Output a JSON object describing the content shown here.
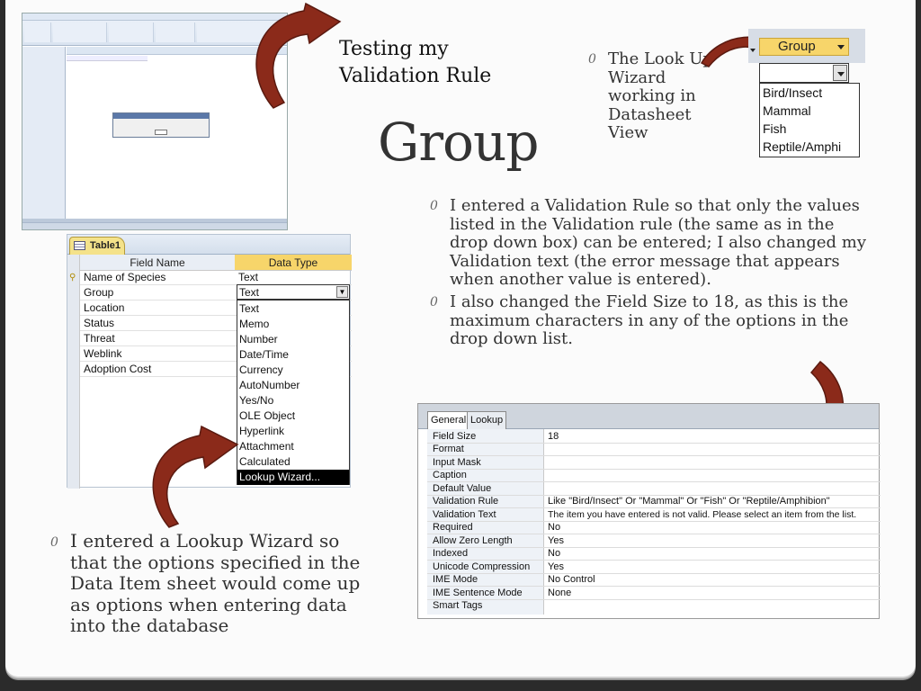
{
  "slide": {
    "title": "Group",
    "testing_label": "Testing my Validation Rule",
    "bullet_mark": "0",
    "lookup_wizard_note": "The Look Up Wizard working in Datasheet View",
    "validation_rule_note": "I entered a Validation Rule so that only the values listed in the Validation rule (the same as in the drop down box) can be entered; I also changed my Validation text (the error message that appears when another value is entered).",
    "field_size_note": " I also changed the Field Size to 18, as this is the maximum characters in any of the options in the drop down list.",
    "lookup_bottom_note": "I entered a Lookup Wizard so that the options specified in the Data Item sheet would come up as options when entering data into the database"
  },
  "arrow_color": "#8b2a1a",
  "design_view": {
    "tab_label": "Table1",
    "col_field_name": "Field Name",
    "col_data_type": "Data Type",
    "header_color": "#f7d56a",
    "fields": [
      {
        "name": "Name of Species",
        "type": "Text"
      },
      {
        "name": "Group",
        "type": "Text"
      },
      {
        "name": "Location",
        "type": ""
      },
      {
        "name": "Status",
        "type": ""
      },
      {
        "name": "Threat",
        "type": ""
      },
      {
        "name": "Weblink",
        "type": ""
      },
      {
        "name": "Adoption Cost",
        "type": ""
      }
    ],
    "type_options": [
      "Text",
      "Memo",
      "Number",
      "Date/Time",
      "Currency",
      "AutoNumber",
      "Yes/No",
      "OLE Object",
      "Hyperlink",
      "Attachment",
      "Calculated",
      "Lookup Wizard..."
    ],
    "highlighted_option": "Lookup Wizard..."
  },
  "group_dropdown": {
    "header": "Group",
    "options": [
      "Bird/Insect",
      "Mammal",
      "Fish",
      "Reptile/Amphi"
    ]
  },
  "field_properties": {
    "tab_general": "General",
    "tab_lookup": "Lookup",
    "rows": [
      {
        "name": "Field Size",
        "value": "18"
      },
      {
        "name": "Format",
        "value": ""
      },
      {
        "name": "Input Mask",
        "value": ""
      },
      {
        "name": "Caption",
        "value": ""
      },
      {
        "name": "Default Value",
        "value": ""
      },
      {
        "name": "Validation Rule",
        "value": "Like \"Bird/Insect\" Or \"Mammal\" Or \"Fish\" Or \"Reptile/Amphibion\""
      },
      {
        "name": "Validation Text",
        "value": "The item you have entered is not valid. Please select an item from the list."
      },
      {
        "name": "Required",
        "value": "No"
      },
      {
        "name": "Allow Zero Length",
        "value": "Yes"
      },
      {
        "name": "Indexed",
        "value": "No"
      },
      {
        "name": "Unicode Compression",
        "value": "Yes"
      },
      {
        "name": "IME Mode",
        "value": "No Control"
      },
      {
        "name": "IME Sentence Mode",
        "value": "None"
      },
      {
        "name": "Smart Tags",
        "value": ""
      }
    ]
  }
}
